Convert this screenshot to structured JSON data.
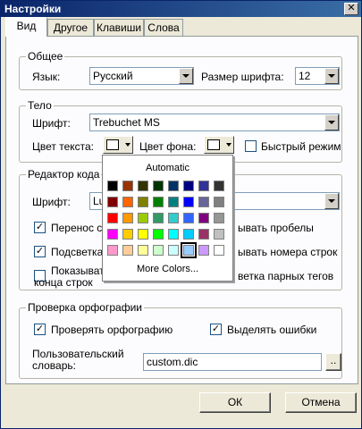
{
  "window": {
    "title": "Настройки",
    "close_glyph": "✕"
  },
  "tabs": [
    {
      "label": "Вид",
      "active": true
    },
    {
      "label": "Другое"
    },
    {
      "label": "Клавиши"
    },
    {
      "label": "Слова"
    }
  ],
  "general": {
    "legend": "Общее",
    "language_label": "Язык:",
    "language_value": "Русский",
    "font_size_label": "Размер шрифта:",
    "font_size_value": "12"
  },
  "body_group": {
    "legend": "Тело",
    "font_label": "Шрифт:",
    "font_value": "Trebuchet MS",
    "text_color_label": "Цвет текста:",
    "bg_color_label": "Цвет фона:",
    "fast_mode_label": "Быстрый режим",
    "fast_mode_checked": false
  },
  "editor": {
    "legend": "Редактор кода",
    "font_label": "Шрифт:",
    "font_value": "Lu",
    "wrap_label": "Перенос с",
    "wrap_checked": true,
    "show_spaces_label": "ывать пробелы",
    "highlight_label": "Подсветка",
    "highlight_checked": true,
    "line_numbers_label": "ывать номера строк",
    "show_ends_label_1": "Показыват",
    "show_ends_label_2": "конца строк",
    "show_ends_checked": false,
    "pair_tags_label": "ветка парных тегов"
  },
  "spelling": {
    "legend": "Проверка орфографии",
    "check_label": "Проверять орфографию",
    "check_checked": true,
    "highlight_errors_label": "Выделять ошибки",
    "highlight_errors_checked": true,
    "dict_label_1": "Пользовательский",
    "dict_label_2": "словарь:",
    "dict_value": "custom.dic",
    "browse_label": ".."
  },
  "color_popup": {
    "automatic_label": "Automatic",
    "more_colors_label": "More Colors...",
    "colors": [
      "#000000",
      "#993300",
      "#333300",
      "#003300",
      "#003366",
      "#000080",
      "#333399",
      "#333333",
      "#800000",
      "#ff6600",
      "#808000",
      "#008000",
      "#008080",
      "#0000ff",
      "#666699",
      "#808080",
      "#ff0000",
      "#ff9900",
      "#99cc00",
      "#339966",
      "#33cccc",
      "#3366ff",
      "#800080",
      "#969696",
      "#ff00ff",
      "#ffcc00",
      "#ffff00",
      "#00ff00",
      "#00ffff",
      "#00ccff",
      "#993366",
      "#c0c0c0",
      "#ff99cc",
      "#ffcc99",
      "#ffff99",
      "#ccffcc",
      "#ccffff",
      "#99ccff",
      "#cc99ff",
      "#ffffff"
    ],
    "selected_index": 37
  },
  "footer": {
    "ok_label": "ОК",
    "cancel_label": "Отмена"
  }
}
